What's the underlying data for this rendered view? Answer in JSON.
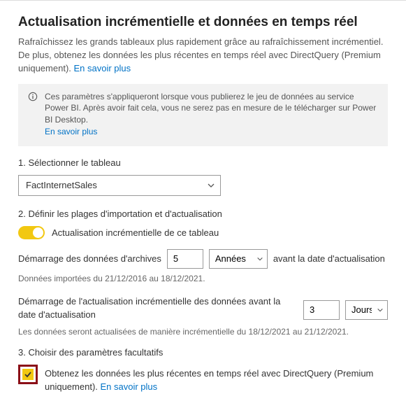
{
  "header": {
    "title": "Actualisation incrémentielle et données en temps réel",
    "intro": "Rafraîchissez les grands tableaux plus rapidement grâce au rafraîchissement incrémentiel. De plus, obtenez les données les plus récentes en temps réel avec DirectQuery (Premium uniquement). ",
    "learnMore": "En savoir plus"
  },
  "infobox": {
    "text": "Ces paramètres s'appliqueront lorsque vous publierez le jeu de données au service Power BI. Après avoir fait cela, vous ne serez pas en mesure de le télécharger sur Power BI Desktop. ",
    "learnMore": "En savoir plus"
  },
  "section1": {
    "label": "1. Sélectionner le tableau",
    "selected": "FactInternetSales"
  },
  "section2": {
    "label": "2. Définir les plages d'importation et d'actualisation",
    "toggleLabel": "Actualisation incrémentielle de ce tableau",
    "archive": {
      "label": "Démarrage des données d'archives",
      "value": "5",
      "unit": "Années",
      "suffix": "avant la date d'actualisation"
    },
    "archiveNote": "Données importées du 21/12/2016 au 18/12/2021.",
    "refresh": {
      "label": "Démarrage de l'actualisation incrémentielle des données avant la date d'actualisation",
      "value": "3",
      "unit": "Jours"
    },
    "refreshNote": "Les données seront actualisées de manière incrémentielle du 18/12/2021 au 21/12/2021."
  },
  "section3": {
    "label": "3. Choisir des paramètres facultatifs",
    "realtime": {
      "label": "Obtenez les données les plus récentes en temps réel avec DirectQuery (Premium uniquement). ",
      "learnMore": "En savoir plus"
    }
  }
}
